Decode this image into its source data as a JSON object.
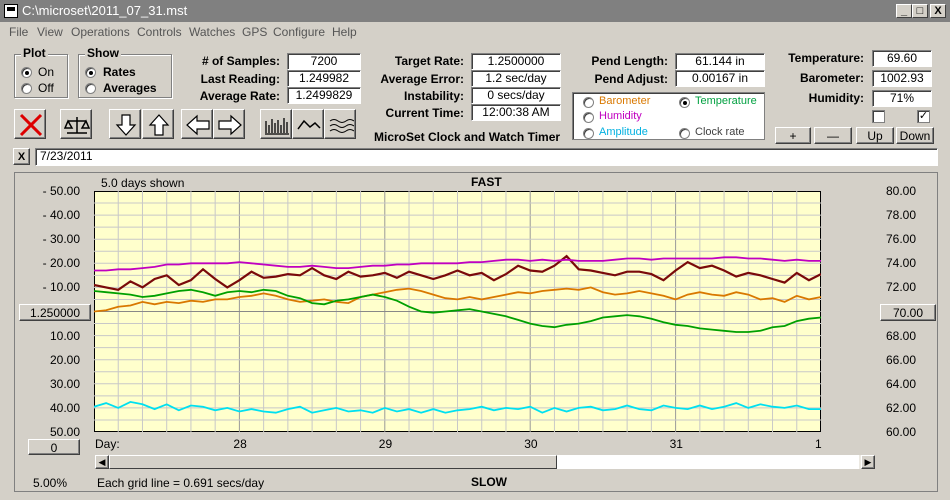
{
  "window": {
    "title": "C:\\microset\\2011_07_31.mst"
  },
  "title_buttons": {
    "minimize": "_",
    "maximize": "□",
    "close": "X"
  },
  "menu": [
    "File",
    "View",
    "Operations",
    "Controls",
    "Watches",
    "GPS",
    "Configure",
    "Help"
  ],
  "plot_group": {
    "caption": "Plot",
    "on_label": "On",
    "off_label": "Off",
    "selected": "On"
  },
  "show_group": {
    "caption": "Show",
    "rates_label": "Rates",
    "averages_label": "Averages",
    "selected": "Rates"
  },
  "stats": {
    "samples_label": "# of Samples:",
    "samples_value": "7200",
    "last_reading_label": "Last Reading:",
    "last_reading_value": "1.249982",
    "average_rate_label": "Average Rate:",
    "average_rate_value": "1.2499829"
  },
  "target": {
    "target_rate_label": "Target Rate:",
    "target_rate_value": "1.2500000",
    "average_error_label": "Average Error:",
    "average_error_value": "1.2 sec/day",
    "instability_label": "Instability:",
    "instability_value": "0 secs/day",
    "current_time_label": "Current Time:",
    "current_time_value": "12:00:38 AM",
    "app_caption": "MicroSet Clock and Watch Timer"
  },
  "pendulum": {
    "pend_length_label": "Pend Length:",
    "pend_length_value": "61.144 in",
    "pend_adjust_label": "Pend Adjust:",
    "pend_adjust_value": "0.00167 in"
  },
  "sensor_options": [
    {
      "label": "Barometer",
      "color": "#d97800",
      "selected": false
    },
    {
      "label": "Temperature",
      "color": "#00a040",
      "selected": true
    },
    {
      "label": "Humidity",
      "color": "#c000c0",
      "selected": false
    },
    {
      "label": "Clock rate",
      "color": "#404040",
      "selected": false
    },
    {
      "label": "Amplitude",
      "color": "#00b0e0",
      "selected": false
    }
  ],
  "environment": {
    "temperature_label": "Temperature:",
    "temperature_value": "69.60",
    "barometer_label": "Barometer:",
    "barometer_value": "1002.93",
    "humidity_label": "Humidity:",
    "humidity_value": "71%",
    "check1": false,
    "check2": true
  },
  "scale_buttons": {
    "plus": "+",
    "minus": "—",
    "up": "Up",
    "down": "Down"
  },
  "toolbar_icons": [
    "clear-icon",
    "balance-icon",
    "arrow-down-icon",
    "arrow-up-icon",
    "arrow-left-icon",
    "arrow-right-icon",
    "bar-graph-icon",
    "wave-icon",
    "multi-wave-icon"
  ],
  "date_bar": {
    "close": "X",
    "date": "7/23/2011"
  },
  "chart_panel": {
    "days_shown": "5.0 days shown",
    "top_label": "FAST",
    "bottom_label": "SLOW",
    "left_button": "1.250000",
    "right_button": "70.00",
    "bottom_left_button": "0",
    "percent": "5.00%",
    "grid_note": "Each grid line = 0.691 secs/day",
    "day_label": "Day:"
  },
  "chart_data": {
    "type": "line",
    "left_axis_ticks": [
      "- 50.00",
      "- 40.00",
      "- 30.00",
      "- 20.00",
      "- 10.00",
      "10.00",
      "20.00",
      "30.00",
      "40.00",
      "50.00"
    ],
    "right_axis_ticks": [
      "80.00",
      "78.00",
      "76.00",
      "74.00",
      "72.00",
      "68.00",
      "66.00",
      "64.00",
      "62.00",
      "60.00"
    ],
    "right_ylim": [
      60,
      80
    ],
    "x_ticks": [
      "28",
      "29",
      "30",
      "31",
      "1"
    ],
    "xlim": [
      0,
      5
    ],
    "grid": true,
    "background": "#ffffcc",
    "series": [
      {
        "color": "#7a0a0a",
        "values_right_axis": [
          72.2,
          72.0,
          71.8,
          72.5,
          72.0,
          72.7,
          73.0,
          72.2,
          72.6,
          73.5,
          72.7,
          72.0,
          72.6,
          73.3,
          72.8,
          72.9,
          73.1,
          73.0,
          73.6,
          73.0,
          72.7,
          73.3,
          72.9,
          73.0,
          73.2,
          72.8,
          73.3,
          73.0,
          72.7,
          73.0,
          73.4,
          73.0,
          73.2,
          72.6,
          73.1,
          73.8,
          73.4,
          73.3,
          73.8,
          74.6,
          73.5,
          73.4,
          73.2,
          73.0,
          73.3,
          73.3,
          73.1,
          72.6,
          73.4,
          74.1,
          73.6,
          73.8,
          73.4,
          72.9,
          73.2,
          73.0,
          72.7,
          72.4,
          73.2,
          72.6,
          73.1
        ]
      },
      {
        "color": "#d97800",
        "values_right_axis": [
          70.0,
          70.1,
          70.4,
          70.5,
          70.8,
          70.6,
          70.8,
          70.7,
          70.9,
          70.8,
          71.0,
          71.0,
          71.2,
          71.3,
          71.5,
          71.3,
          71.0,
          70.8,
          70.9,
          71.0,
          70.8,
          70.7,
          71.2,
          71.4,
          71.6,
          71.8,
          71.9,
          71.7,
          71.4,
          71.1,
          71.0,
          71.2,
          71.0,
          71.2,
          71.4,
          71.6,
          71.5,
          71.7,
          71.8,
          71.9,
          71.8,
          72.0,
          71.6,
          71.4,
          71.5,
          71.7,
          71.5,
          71.3,
          71.0,
          71.4,
          71.6,
          71.4,
          71.3,
          71.6,
          71.4,
          71.0,
          71.1,
          70.8,
          71.3,
          71.0,
          71.2
        ]
      },
      {
        "color": "#00a000",
        "values_right_axis": [
          71.7,
          71.6,
          71.5,
          71.4,
          71.2,
          71.3,
          71.5,
          71.7,
          71.8,
          71.6,
          71.3,
          71.6,
          71.7,
          71.6,
          71.8,
          71.7,
          71.3,
          71.1,
          70.7,
          70.6,
          70.9,
          71.0,
          71.2,
          71.4,
          71.2,
          70.9,
          70.4,
          70.0,
          69.9,
          70.0,
          70.1,
          70.2,
          70.0,
          69.8,
          69.6,
          69.3,
          69.0,
          68.8,
          68.7,
          68.9,
          69.0,
          69.2,
          69.5,
          69.6,
          69.7,
          69.6,
          69.4,
          69.1,
          68.9,
          68.8,
          68.6,
          68.5,
          68.4,
          68.3,
          68.3,
          68.4,
          68.7,
          68.8,
          69.2,
          69.4,
          69.5
        ]
      },
      {
        "color": "#c000c0",
        "values_right_axis": [
          73.4,
          73.4,
          73.5,
          73.5,
          73.6,
          73.7,
          73.9,
          73.9,
          74.0,
          74.0,
          74.0,
          74.0,
          74.1,
          74.0,
          73.9,
          73.8,
          73.7,
          73.7,
          73.8,
          73.7,
          73.6,
          73.6,
          73.7,
          73.8,
          73.8,
          73.9,
          73.9,
          74.0,
          74.0,
          74.0,
          74.0,
          74.1,
          74.1,
          74.2,
          74.3,
          74.3,
          74.2,
          74.3,
          74.2,
          74.3,
          74.2,
          74.2,
          74.2,
          74.3,
          74.4,
          74.4,
          74.3,
          74.4,
          74.4,
          74.4,
          74.4,
          74.4,
          74.5,
          74.5,
          74.4,
          74.4,
          74.3,
          74.2,
          74.3,
          74.2,
          74.2
        ]
      },
      {
        "color": "#00e0f0",
        "values_right_axis": [
          62.1,
          62.4,
          62.0,
          62.5,
          62.3,
          61.9,
          62.3,
          61.8,
          62.2,
          62.1,
          61.8,
          62.0,
          61.7,
          61.9,
          61.7,
          61.6,
          61.9,
          62.1,
          61.6,
          61.8,
          62.0,
          61.7,
          61.8,
          61.6,
          62.0,
          61.7,
          61.9,
          61.6,
          61.9,
          61.6,
          61.8,
          61.9,
          62.1,
          61.8,
          62.0,
          61.9,
          62.1,
          61.6,
          62.0,
          61.7,
          62.0,
          62.1,
          61.8,
          61.9,
          62.2,
          61.9,
          61.8,
          62.2,
          62.0,
          61.9,
          62.2,
          61.9,
          62.1,
          62.4,
          62.0,
          62.3,
          62.1,
          62.0,
          62.2,
          61.9,
          61.9
        ]
      }
    ]
  }
}
